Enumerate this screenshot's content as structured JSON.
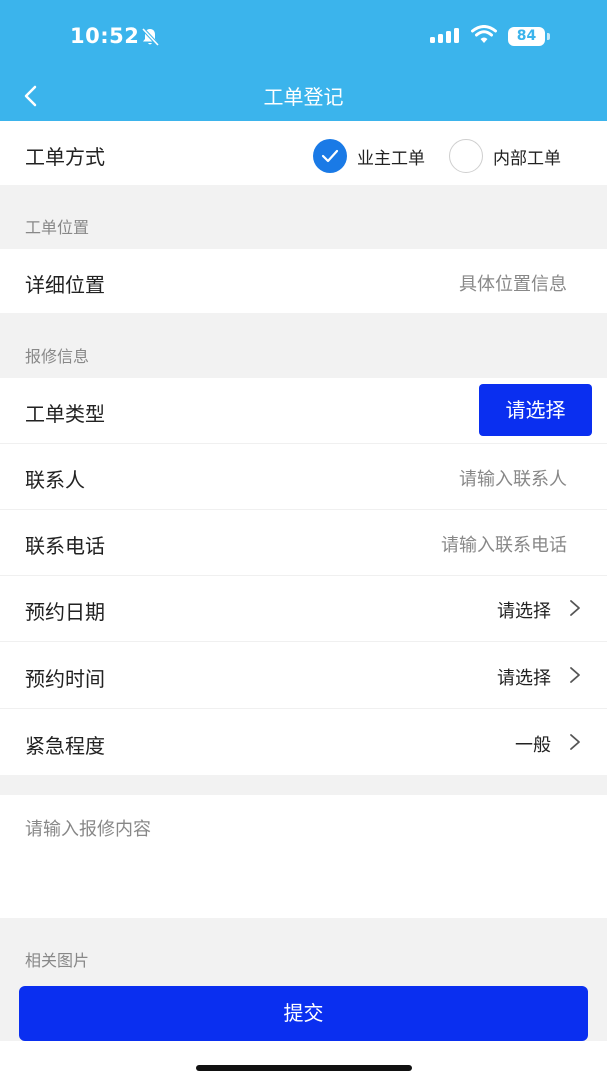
{
  "status_bar": {
    "time": "10:52",
    "battery": "84",
    "icons": [
      "bell-slash-icon",
      "signal-icon",
      "wifi-icon",
      "battery-icon"
    ]
  },
  "nav": {
    "back_icon": "chevron-left-icon",
    "title": "工单登记"
  },
  "work_order_mode": {
    "label": "工单方式",
    "options": [
      {
        "label": "业主工单",
        "checked": true
      },
      {
        "label": "内部工单",
        "checked": false
      }
    ]
  },
  "location_section": {
    "title": "工单位置",
    "detail_label": "详细位置",
    "detail_placeholder": "具体位置信息"
  },
  "repair_section": {
    "title": "报修信息",
    "type_label": "工单类型",
    "type_button": "请选择",
    "contact_label": "联系人",
    "contact_placeholder": "请输入联系人",
    "phone_label": "联系电话",
    "phone_placeholder": "请输入联系电话",
    "date_label": "预约日期",
    "date_value": "请选择",
    "time_label": "预约时间",
    "time_value": "请选择",
    "urgency_label": "紧急程度",
    "urgency_value": "一般"
  },
  "content": {
    "placeholder": "请输入报修内容"
  },
  "images_section": {
    "title": "相关图片"
  },
  "submit": {
    "label": "提交"
  },
  "colors": {
    "header": "#3bb4ec",
    "primary_button": "#0a2ff0",
    "radio_checked": "#1a7ae6"
  }
}
